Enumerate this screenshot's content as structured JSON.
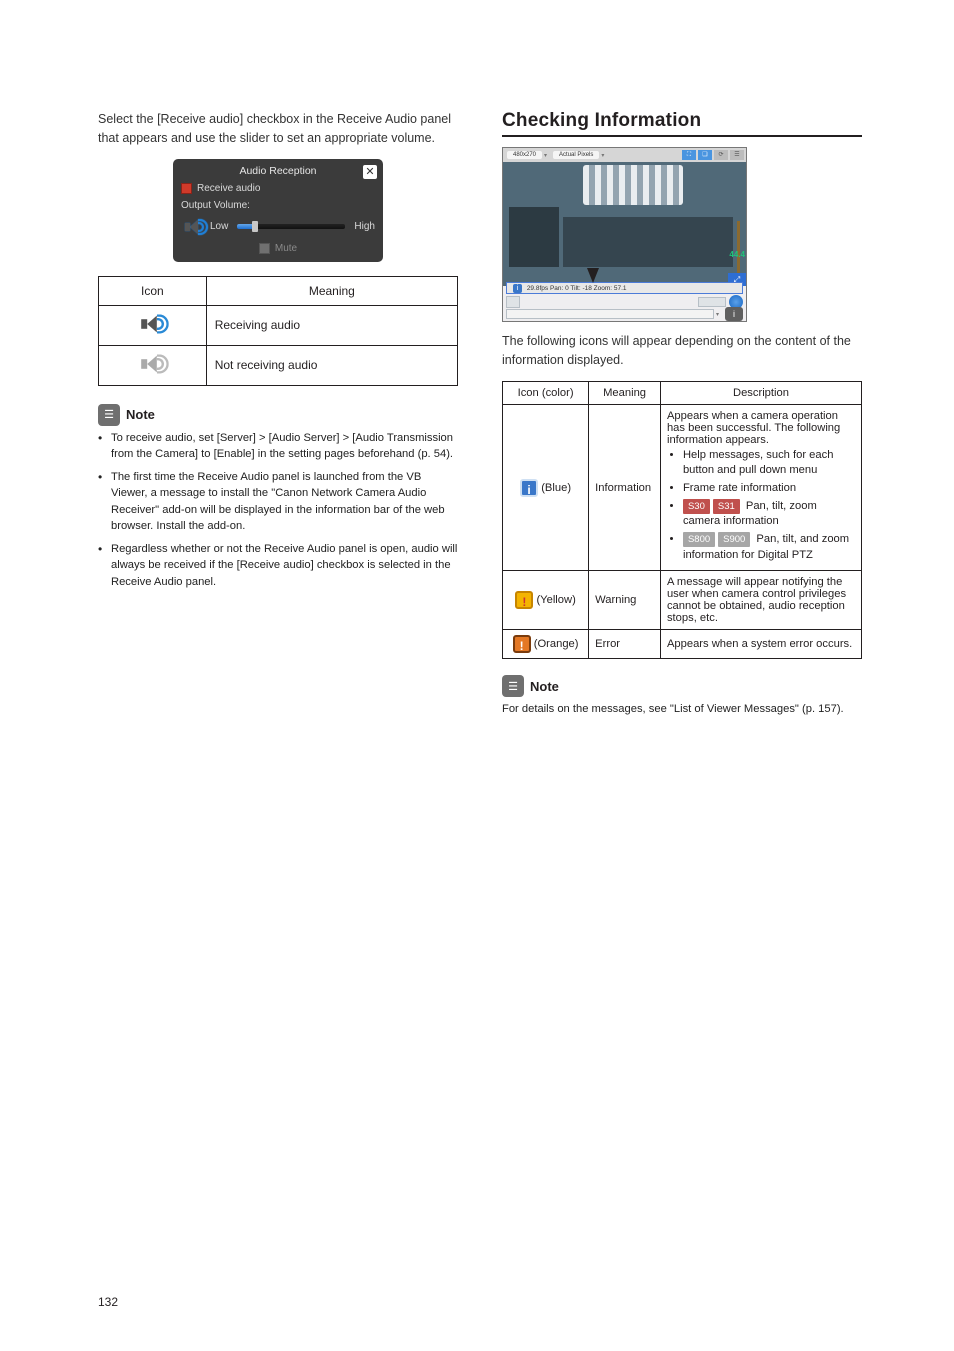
{
  "left": {
    "intro": "Select the [Receive audio] checkbox in the Receive Audio panel that appears and use the slider to set an appropriate volume.",
    "panel": {
      "title": "Audio Reception",
      "receive_label": "Receive audio",
      "output_label": "Output Volume:",
      "low": "Low",
      "high": "High",
      "mute": "Mute"
    },
    "tbl": {
      "h1": "Icon",
      "h2": "Meaning",
      "r1": "Receiving audio",
      "r2": "Not receiving audio"
    },
    "note_label": "Note",
    "notes": [
      "To receive audio, set [Server] > [Audio Server] > [Audio Transmission from the Camera] to [Enable] in the setting pages beforehand (p. 54).",
      "The first time the Receive Audio panel is launched from the VB Viewer, a message to install the \"Canon Network Camera Audio Receiver\" add-on will be displayed in the information bar of the web browser. Install the add-on.",
      "Regardless whether or not the Receive Audio panel is open, audio will always be received if the [Receive audio] checkbox is selected in the Receive Audio panel."
    ]
  },
  "right": {
    "heading": "Checking Information",
    "shot": {
      "res": "480x270",
      "fit": "Actual Pixels",
      "status_line": "29.8fps Pan: 0 Tilt: -18 Zoom: 57.1",
      "fade": "44.4"
    },
    "intro": "The following icons will appear depending on the content of the information displayed.",
    "tbl": {
      "h1": "Icon (color)",
      "h2": "Meaning",
      "h3": "Description",
      "rows": [
        {
          "icon_color": "(Blue)",
          "meaning": "Information",
          "desc_lead": "Appears when a camera operation has been successful. The following information appears.",
          "b1": "Help messages, such for each button and pull down menu",
          "b2": "Frame rate information",
          "b3a": "S30",
          "b3b": "S31",
          "b3t": " Pan, tilt, zoom camera information",
          "b4a": "S800",
          "b4b": "S900",
          "b4t": " Pan, tilt, and zoom information for Digital PTZ"
        },
        {
          "icon_color": "(Yellow)",
          "meaning": "Warning",
          "desc": "A message will appear notifying the user when camera control privileges cannot be obtained, audio reception stops, etc."
        },
        {
          "icon_color": "(Orange)",
          "meaning": "Error",
          "desc": "Appears when a system error occurs."
        }
      ]
    },
    "note_label": "Note",
    "note_text": "For details on the messages, see \"List of Viewer Messages\" (p. 157)."
  },
  "page_number": "132"
}
